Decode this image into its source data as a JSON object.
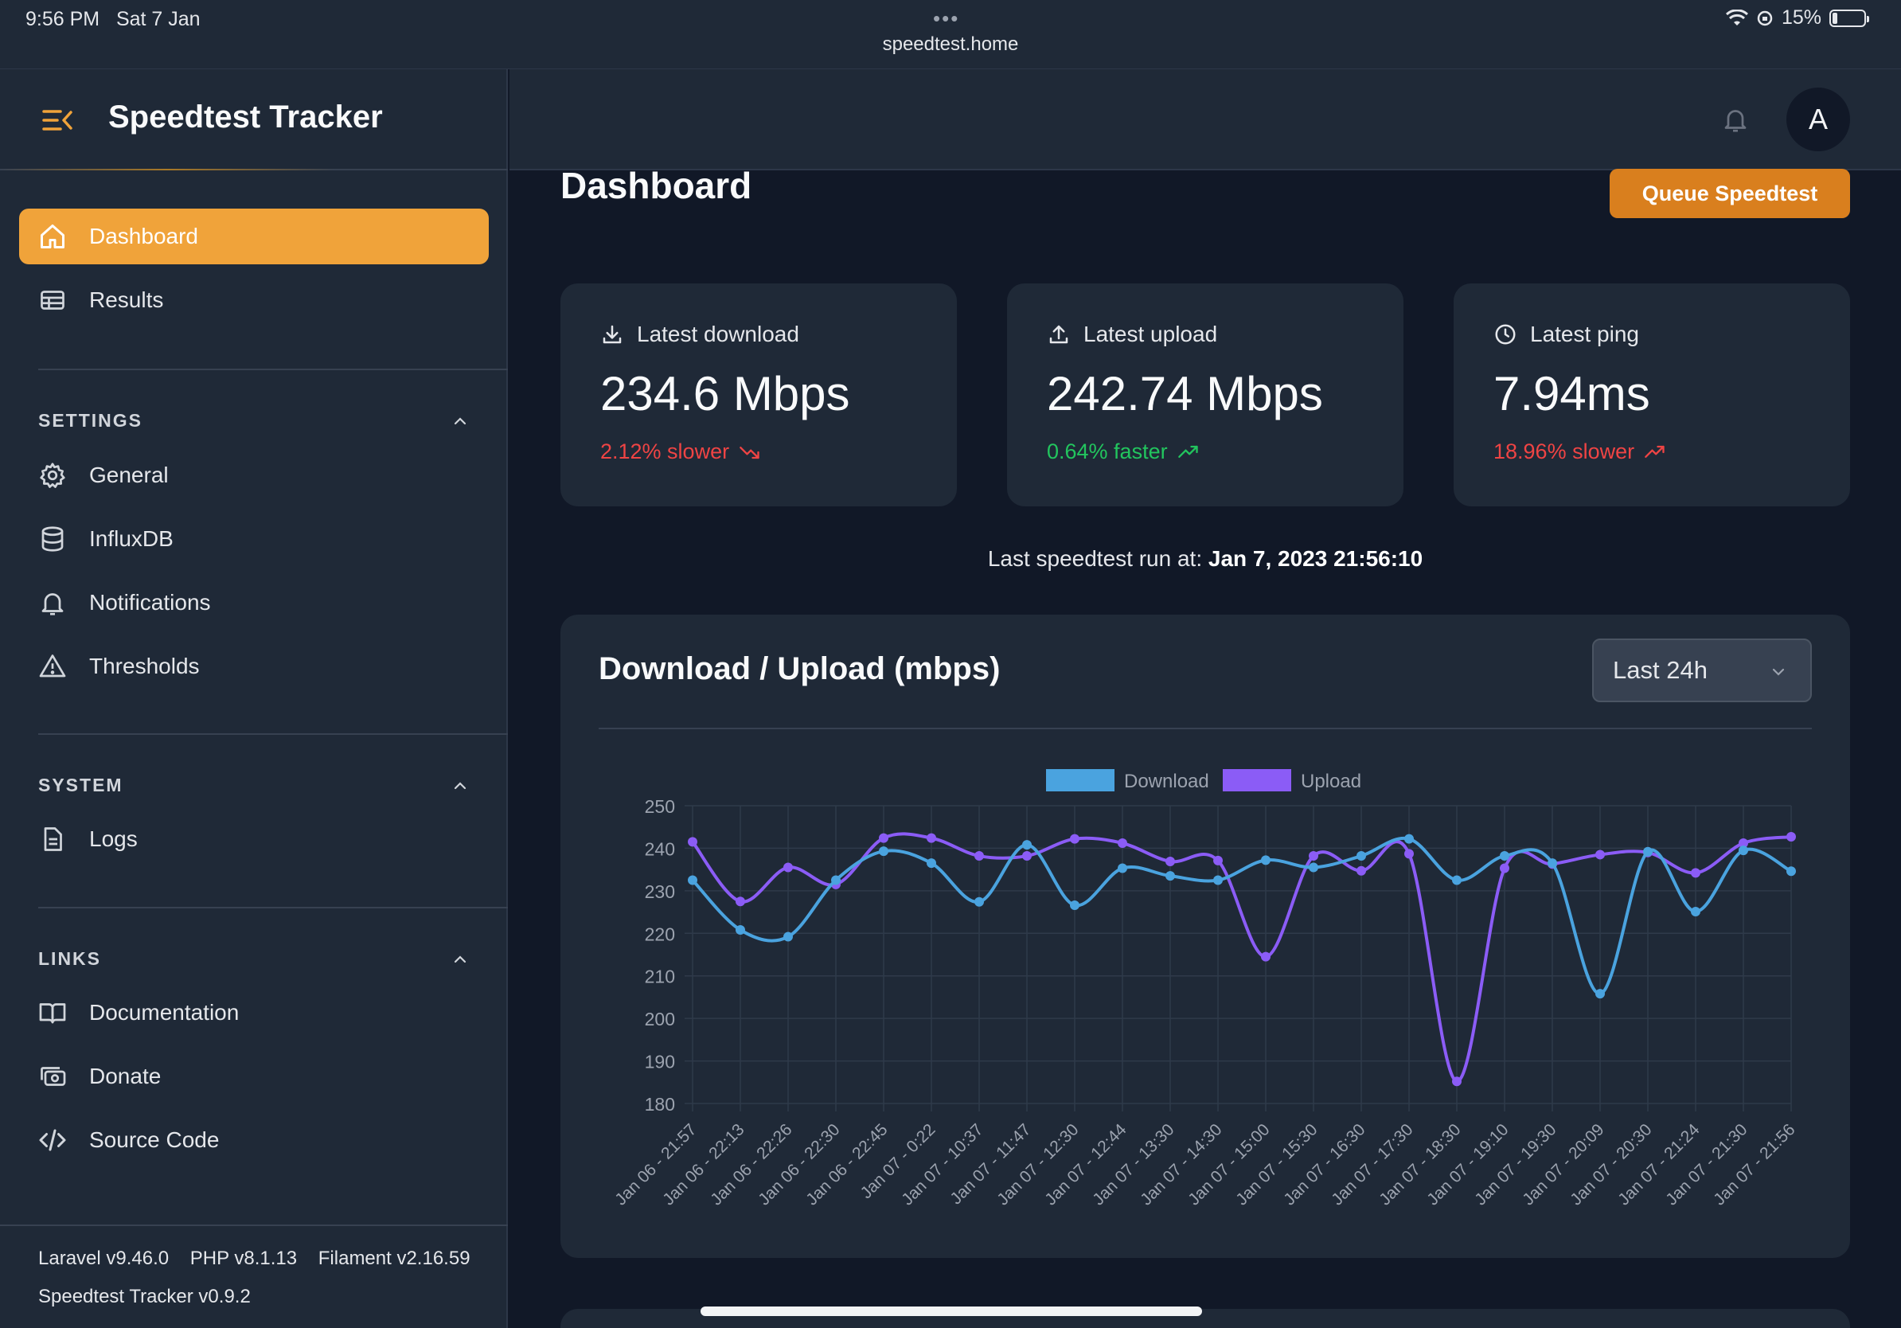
{
  "statusbar": {
    "time": "9:56 PM",
    "date": "Sat 7 Jan",
    "url": "speedtest.home",
    "battery": "15%",
    "battery_level": 0.15
  },
  "sidebar": {
    "brand": "Speedtest Tracker",
    "nav": [
      {
        "label": "Dashboard",
        "icon": "home-icon"
      },
      {
        "label": "Results",
        "icon": "table-icon"
      }
    ],
    "settings": {
      "label": "SETTINGS",
      "items": [
        {
          "label": "General",
          "icon": "gear-icon"
        },
        {
          "label": "InfluxDB",
          "icon": "database-icon"
        },
        {
          "label": "Notifications",
          "icon": "bell-icon"
        },
        {
          "label": "Thresholds",
          "icon": "warning-icon"
        }
      ]
    },
    "system": {
      "label": "SYSTEM",
      "items": [
        {
          "label": "Logs",
          "icon": "document-icon"
        }
      ]
    },
    "links": {
      "label": "LINKS",
      "items": [
        {
          "label": "Documentation",
          "icon": "book-icon"
        },
        {
          "label": "Donate",
          "icon": "cash-icon"
        },
        {
          "label": "Source Code",
          "icon": "code-icon"
        }
      ]
    },
    "footer": {
      "laravel": "Laravel v9.46.0",
      "php": "PHP v8.1.13",
      "filament": "Filament v2.16.59",
      "app": "Speedtest Tracker v0.9.2"
    }
  },
  "header": {
    "avatar": "A",
    "page_title": "Dashboard",
    "queue_button": "Queue Speedtest"
  },
  "stats": {
    "download": {
      "label": "Latest download",
      "value": "234.6 Mbps",
      "delta": "2.12% slower"
    },
    "upload": {
      "label": "Latest upload",
      "value": "242.74 Mbps",
      "delta": "0.64% faster"
    },
    "ping": {
      "label": "Latest ping",
      "value": "7.94ms",
      "delta": "18.96% slower"
    }
  },
  "last_run": {
    "prefix": "Last speedtest run at: ",
    "value": "Jan 7, 2023 21:56:10"
  },
  "chart_section": {
    "title": "Download / Upload (mbps)",
    "range_select": "Last 24h"
  },
  "colors": {
    "accent": "#f0a33a",
    "download": "#4aa3df",
    "upload": "#8b5cf6",
    "slower": "#ef4444",
    "faster": "#22c55e"
  },
  "chart_data": {
    "type": "line",
    "x": [
      "Jan 06 - 21:57",
      "Jan 06 - 22:13",
      "Jan 06 - 22:26",
      "Jan 06 - 22:30",
      "Jan 06 - 22:45",
      "Jan 07 - 0:22",
      "Jan 07 - 10:37",
      "Jan 07 - 11:47",
      "Jan 07 - 12:30",
      "Jan 07 - 12:44",
      "Jan 07 - 13:30",
      "Jan 07 - 14:30",
      "Jan 07 - 15:00",
      "Jan 07 - 15:30",
      "Jan 07 - 16:30",
      "Jan 07 - 17:30",
      "Jan 07 - 18:30",
      "Jan 07 - 19:10",
      "Jan 07 - 19:30",
      "Jan 07 - 20:09",
      "Jan 07 - 20:30",
      "Jan 07 - 21:24",
      "Jan 07 - 21:30",
      "Jan 07 - 21:56"
    ],
    "series": [
      {
        "name": "Download",
        "values": [
          232.5,
          220.8,
          219.2,
          232.5,
          239.3,
          236.5,
          227.4,
          240.8,
          226.6,
          235.3,
          233.5,
          232.5,
          237.2,
          235.5,
          238.2,
          242.2,
          232.5,
          238.2,
          236.5,
          205.8,
          239.2,
          225.1,
          239.5,
          234.6
        ]
      },
      {
        "name": "Upload",
        "values": [
          241.5,
          227.5,
          235.5,
          231.5,
          242.4,
          242.4,
          238.2,
          238.2,
          242.2,
          241.2,
          236.9,
          237.1,
          214.5,
          238.2,
          234.7,
          238.7,
          185.2,
          235.3,
          236.3,
          238.5,
          239.0,
          234.2,
          241.2,
          242.7
        ]
      }
    ],
    "ylim": [
      180,
      250
    ],
    "yticks": [
      250,
      240,
      230,
      220,
      210,
      200,
      190,
      180
    ],
    "grid": true,
    "legend": "top-center"
  }
}
